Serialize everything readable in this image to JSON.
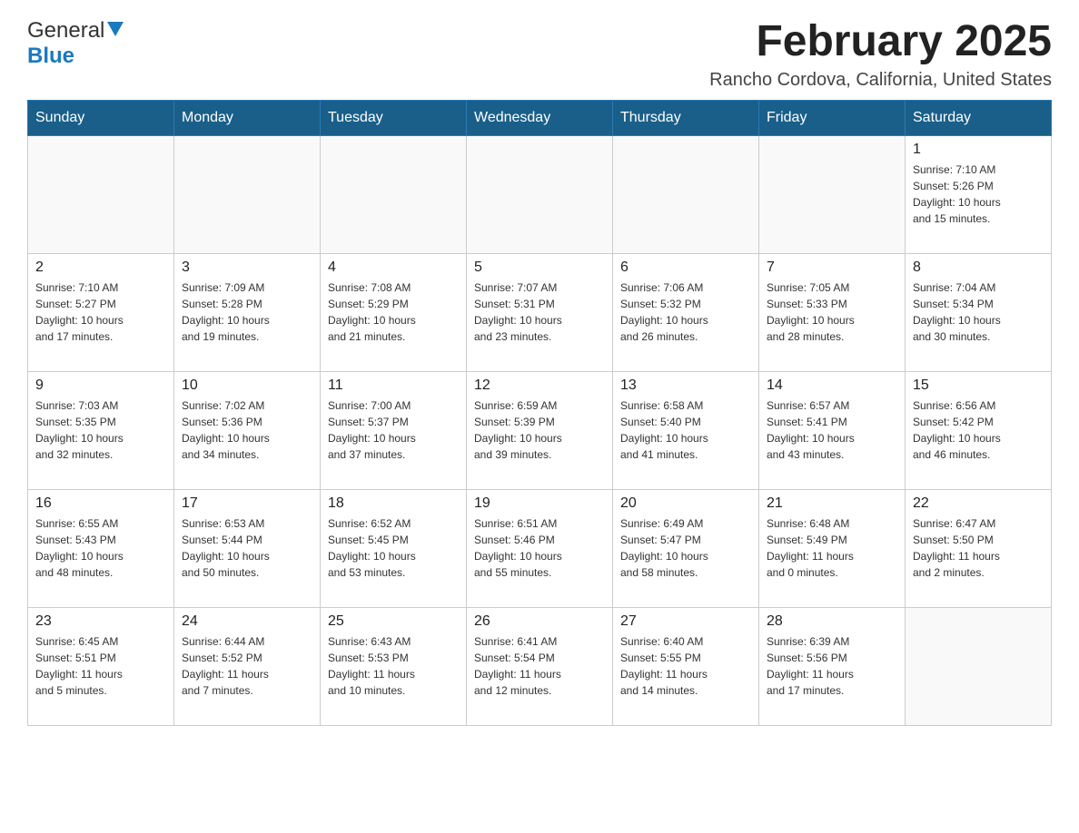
{
  "logo": {
    "general": "General",
    "blue": "Blue"
  },
  "header": {
    "month": "February 2025",
    "location": "Rancho Cordova, California, United States"
  },
  "weekdays": [
    "Sunday",
    "Monday",
    "Tuesday",
    "Wednesday",
    "Thursday",
    "Friday",
    "Saturday"
  ],
  "weeks": [
    [
      {
        "day": "",
        "info": ""
      },
      {
        "day": "",
        "info": ""
      },
      {
        "day": "",
        "info": ""
      },
      {
        "day": "",
        "info": ""
      },
      {
        "day": "",
        "info": ""
      },
      {
        "day": "",
        "info": ""
      },
      {
        "day": "1",
        "info": "Sunrise: 7:10 AM\nSunset: 5:26 PM\nDaylight: 10 hours\nand 15 minutes."
      }
    ],
    [
      {
        "day": "2",
        "info": "Sunrise: 7:10 AM\nSunset: 5:27 PM\nDaylight: 10 hours\nand 17 minutes."
      },
      {
        "day": "3",
        "info": "Sunrise: 7:09 AM\nSunset: 5:28 PM\nDaylight: 10 hours\nand 19 minutes."
      },
      {
        "day": "4",
        "info": "Sunrise: 7:08 AM\nSunset: 5:29 PM\nDaylight: 10 hours\nand 21 minutes."
      },
      {
        "day": "5",
        "info": "Sunrise: 7:07 AM\nSunset: 5:31 PM\nDaylight: 10 hours\nand 23 minutes."
      },
      {
        "day": "6",
        "info": "Sunrise: 7:06 AM\nSunset: 5:32 PM\nDaylight: 10 hours\nand 26 minutes."
      },
      {
        "day": "7",
        "info": "Sunrise: 7:05 AM\nSunset: 5:33 PM\nDaylight: 10 hours\nand 28 minutes."
      },
      {
        "day": "8",
        "info": "Sunrise: 7:04 AM\nSunset: 5:34 PM\nDaylight: 10 hours\nand 30 minutes."
      }
    ],
    [
      {
        "day": "9",
        "info": "Sunrise: 7:03 AM\nSunset: 5:35 PM\nDaylight: 10 hours\nand 32 minutes."
      },
      {
        "day": "10",
        "info": "Sunrise: 7:02 AM\nSunset: 5:36 PM\nDaylight: 10 hours\nand 34 minutes."
      },
      {
        "day": "11",
        "info": "Sunrise: 7:00 AM\nSunset: 5:37 PM\nDaylight: 10 hours\nand 37 minutes."
      },
      {
        "day": "12",
        "info": "Sunrise: 6:59 AM\nSunset: 5:39 PM\nDaylight: 10 hours\nand 39 minutes."
      },
      {
        "day": "13",
        "info": "Sunrise: 6:58 AM\nSunset: 5:40 PM\nDaylight: 10 hours\nand 41 minutes."
      },
      {
        "day": "14",
        "info": "Sunrise: 6:57 AM\nSunset: 5:41 PM\nDaylight: 10 hours\nand 43 minutes."
      },
      {
        "day": "15",
        "info": "Sunrise: 6:56 AM\nSunset: 5:42 PM\nDaylight: 10 hours\nand 46 minutes."
      }
    ],
    [
      {
        "day": "16",
        "info": "Sunrise: 6:55 AM\nSunset: 5:43 PM\nDaylight: 10 hours\nand 48 minutes."
      },
      {
        "day": "17",
        "info": "Sunrise: 6:53 AM\nSunset: 5:44 PM\nDaylight: 10 hours\nand 50 minutes."
      },
      {
        "day": "18",
        "info": "Sunrise: 6:52 AM\nSunset: 5:45 PM\nDaylight: 10 hours\nand 53 minutes."
      },
      {
        "day": "19",
        "info": "Sunrise: 6:51 AM\nSunset: 5:46 PM\nDaylight: 10 hours\nand 55 minutes."
      },
      {
        "day": "20",
        "info": "Sunrise: 6:49 AM\nSunset: 5:47 PM\nDaylight: 10 hours\nand 58 minutes."
      },
      {
        "day": "21",
        "info": "Sunrise: 6:48 AM\nSunset: 5:49 PM\nDaylight: 11 hours\nand 0 minutes."
      },
      {
        "day": "22",
        "info": "Sunrise: 6:47 AM\nSunset: 5:50 PM\nDaylight: 11 hours\nand 2 minutes."
      }
    ],
    [
      {
        "day": "23",
        "info": "Sunrise: 6:45 AM\nSunset: 5:51 PM\nDaylight: 11 hours\nand 5 minutes."
      },
      {
        "day": "24",
        "info": "Sunrise: 6:44 AM\nSunset: 5:52 PM\nDaylight: 11 hours\nand 7 minutes."
      },
      {
        "day": "25",
        "info": "Sunrise: 6:43 AM\nSunset: 5:53 PM\nDaylight: 11 hours\nand 10 minutes."
      },
      {
        "day": "26",
        "info": "Sunrise: 6:41 AM\nSunset: 5:54 PM\nDaylight: 11 hours\nand 12 minutes."
      },
      {
        "day": "27",
        "info": "Sunrise: 6:40 AM\nSunset: 5:55 PM\nDaylight: 11 hours\nand 14 minutes."
      },
      {
        "day": "28",
        "info": "Sunrise: 6:39 AM\nSunset: 5:56 PM\nDaylight: 11 hours\nand 17 minutes."
      },
      {
        "day": "",
        "info": ""
      }
    ]
  ]
}
